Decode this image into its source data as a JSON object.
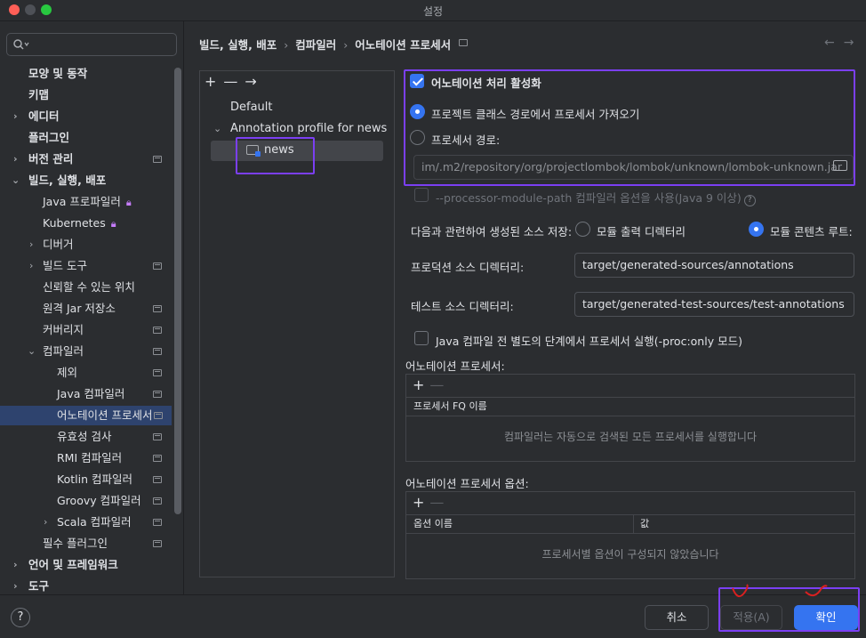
{
  "window": {
    "title": "설정"
  },
  "search": {
    "placeholder": ""
  },
  "sidebar": {
    "items": [
      {
        "label": "모양 및 동작"
      },
      {
        "label": "키맵"
      },
      {
        "label": "에디터"
      },
      {
        "label": "플러그인"
      },
      {
        "label": "버전 관리"
      },
      {
        "label": "빌드, 실행, 배포"
      },
      {
        "label": "Java 프로파일러"
      },
      {
        "label": "Kubernetes"
      },
      {
        "label": "디버거"
      },
      {
        "label": "빌드 도구"
      },
      {
        "label": "신뢰할 수 있는 위치"
      },
      {
        "label": "원격 Jar 저장소"
      },
      {
        "label": "커버리지"
      },
      {
        "label": "컴파일러"
      },
      {
        "label": "제외"
      },
      {
        "label": "Java 컴파일러"
      },
      {
        "label": "어노테이션 프로세서"
      },
      {
        "label": "유효성 검사"
      },
      {
        "label": "RMI 컴파일러"
      },
      {
        "label": "Kotlin 컴파일러"
      },
      {
        "label": "Groovy 컴파일러"
      },
      {
        "label": "Scala 컴파일러"
      },
      {
        "label": "필수 플러그인"
      },
      {
        "label": "언어 및 프레임워크"
      },
      {
        "label": "도구"
      }
    ]
  },
  "breadcrumb": {
    "part1": "빌드, 실행, 배포",
    "part2": "컴파일러",
    "part3": "어노테이션 프로세서",
    "sep": "›"
  },
  "profiles": {
    "toolbar": "+ — →",
    "default": "Default",
    "group": "Annotation profile for news",
    "news": "news"
  },
  "settings": {
    "enable_label": "어노테이션 처리 활성화",
    "enable_checked": true,
    "radio_classpath": "프로젝트 클래스 경로에서 프로세서 가져오기",
    "radio_path": "프로세서 경로:",
    "processor_path_value": "im/.m2/repository/org/projectlombok/lombok/unknown/lombok-unknown.jar",
    "module_path_label": "--processor-module-path 컴파일러 옵션을 사용(Java 9 이상)",
    "store_label": "다음과 관련하여 생성된 소스 저장:",
    "store_opt_output": "모듈 출력 디렉터리",
    "store_opt_content": "모듈 콘텐츠 루트:",
    "prod_dir_label": "프로덕션 소스 디렉터리:",
    "prod_dir_value": "target/generated-sources/annotations",
    "test_dir_label": "테스트 소스 디렉터리:",
    "test_dir_value": "target/generated-test-sources/test-annotations",
    "proc_only_label": "Java 컴파일 전 별도의 단계에서 프로세서 실행(-proc:only 모드)"
  },
  "processors_table": {
    "title": "어노테이션 프로세서:",
    "column": "프로세서 FQ 이름",
    "empty": "컴파일러는 자동으로 검색된 모든 프로세서를 실행합니다"
  },
  "options_table": {
    "title": "어노테이션 프로세서 옵션:",
    "col_name": "옵션 이름",
    "col_value": "값",
    "empty": "프로세서별 옵션이 구성되지 않았습니다"
  },
  "footer": {
    "help": "?",
    "cancel": "취소",
    "apply": "적용(A)",
    "ok": "확인"
  },
  "colors": {
    "accent": "#3574f0",
    "annotation": "#7b3ff2",
    "selection": "#2e436e"
  }
}
